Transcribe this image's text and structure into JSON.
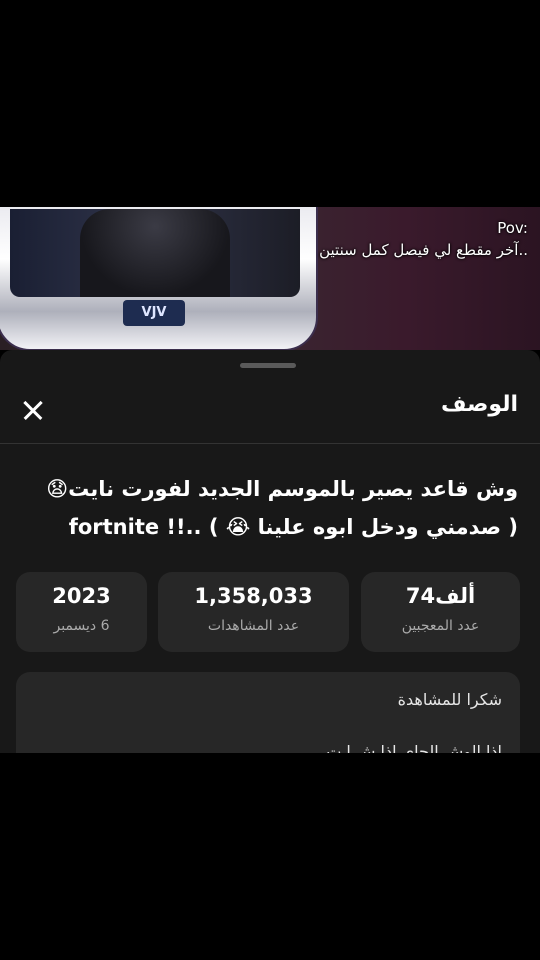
{
  "overlay": {
    "line1": "Pov:",
    "line2": "آخر مقطع لي فيصل كمل سنتين.."
  },
  "video": {
    "monitor_logo": "VJV"
  },
  "panel": {
    "title": "الوصف",
    "video_title_line1": "وش قاعد يصير بالموسم الجديد لفورت نايت😧",
    "video_title_line2": "( صدمني ودخل ابوه علينا 😭 ) ..!! fortnite",
    "stats": {
      "likes_value": "74ألف",
      "likes_label": "عدد المعجبين",
      "views_value": "1,358,033",
      "views_label": "عدد المشاهدات",
      "year_value": "2023",
      "date_label": "6 ديسمبر"
    },
    "description": {
      "line1": "شكرا للمشاهدة",
      "line2": "اذا الوش الجاي اذا ش ا ت"
    }
  }
}
